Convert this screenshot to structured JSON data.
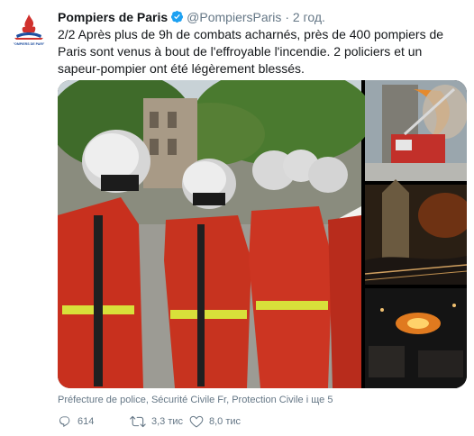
{
  "tweet": {
    "author_name": "Pompiers de Paris",
    "handle": "@PompiersParis",
    "separator": "·",
    "time": "2 год.",
    "text": "2/2 Après plus de 9h de combats acharnés, près de 400 pompiers de Paris sont venus à bout de l'effroyable l'incendie. 2 policiers et un sapeur-pompier ont été légèrement blessés.",
    "avatar_caption": "POMPIERS DE PARIS",
    "media_credit": "Préfecture de police, Sécurité Civile Fr, Protection Civile і ще 5",
    "replies": "614",
    "retweets": "3,3 тис",
    "likes": "8,0 тис"
  },
  "colors": {
    "verified_blue": "#1da1f2",
    "text_primary": "#14171a",
    "text_secondary": "#657786",
    "avatar_red": "#d0312d",
    "avatar_blue": "#1f4fa0"
  },
  "icons": {
    "verified": "verified-badge-icon",
    "reply": "reply-icon",
    "retweet": "retweet-icon",
    "like": "heart-icon"
  }
}
